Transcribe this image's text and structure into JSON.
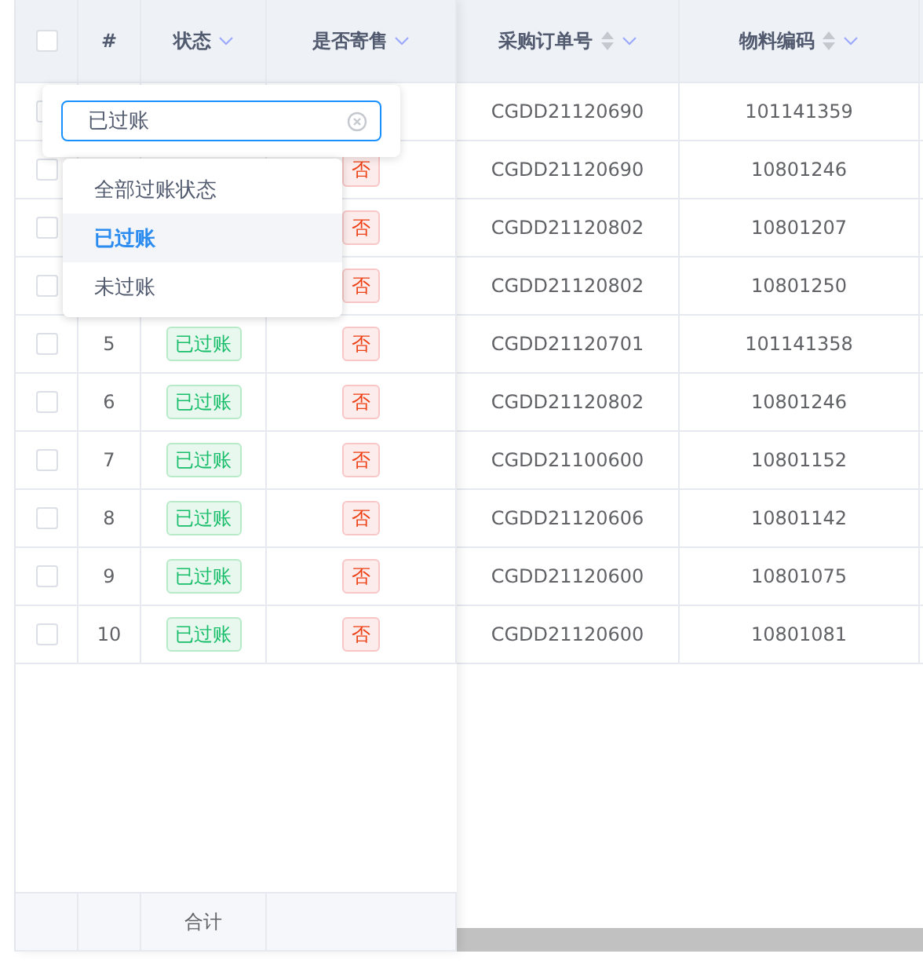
{
  "table": {
    "header_checkbox": {
      "checked": false
    },
    "columns": [
      {
        "label": "#",
        "filter": false,
        "sortable": false
      },
      {
        "label": "状态",
        "filter": true,
        "sortable": false
      },
      {
        "label": "是否寄售",
        "filter": true,
        "sortable": false
      },
      {
        "label": "采购订单号",
        "filter": true,
        "sortable": true
      },
      {
        "label": "物料编码",
        "filter": true,
        "sortable": true
      }
    ],
    "rows": [
      {
        "checked": false,
        "po": "CGDD21120690",
        "material": "101141359"
      },
      {
        "checked": false,
        "consign": "否",
        "po": "CGDD21120690",
        "material": "10801246"
      },
      {
        "checked": false,
        "consign": "否",
        "po": "CGDD21120802",
        "material": "10801207"
      },
      {
        "checked": false,
        "consign": "否",
        "po": "CGDD21120802",
        "material": "10801250"
      },
      {
        "checked": false,
        "index": "5",
        "status": "已过账",
        "consign": "否",
        "po": "CGDD21120701",
        "material": "101141358"
      },
      {
        "checked": false,
        "index": "6",
        "status": "已过账",
        "consign": "否",
        "po": "CGDD21120802",
        "material": "10801246"
      },
      {
        "checked": false,
        "index": "7",
        "status": "已过账",
        "consign": "否",
        "po": "CGDD21100600",
        "material": "10801152"
      },
      {
        "checked": false,
        "index": "8",
        "status": "已过账",
        "consign": "否",
        "po": "CGDD21120606",
        "material": "10801142"
      },
      {
        "checked": false,
        "index": "9",
        "status": "已过账",
        "consign": "否",
        "po": "CGDD21120600",
        "material": "10801075"
      },
      {
        "checked": false,
        "index": "10",
        "status": "已过账",
        "consign": "否",
        "po": "CGDD21120600",
        "material": "10801081"
      }
    ],
    "footer": {
      "label": "合计"
    }
  },
  "filter_popover": {
    "value": "已过账",
    "options": [
      {
        "label": "全部过账状态",
        "selected": false
      },
      {
        "label": "已过账",
        "selected": true
      },
      {
        "label": "未过账",
        "selected": false
      }
    ]
  }
}
